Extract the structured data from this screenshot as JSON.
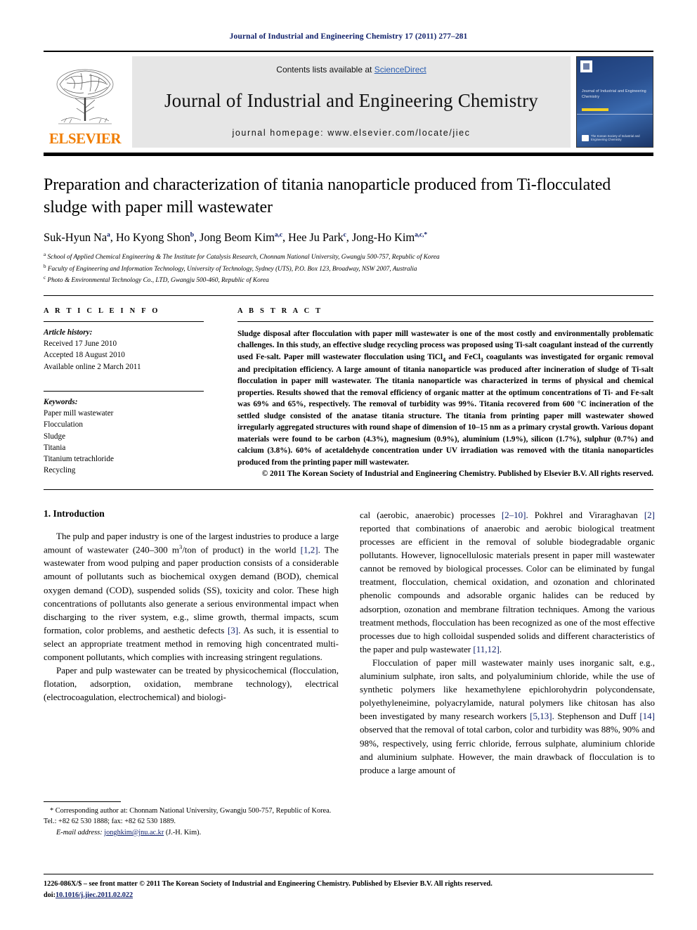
{
  "running_head": "Journal of Industrial and Engineering Chemistry 17 (2011) 277–281",
  "masthead": {
    "publisher_name": "ELSEVIER",
    "contents_prefix": "Contents lists available at ",
    "sciencedirect": "ScienceDirect",
    "journal_name": "Journal of Industrial and Engineering Chemistry",
    "homepage": "journal homepage: www.elsevier.com/locate/jiec",
    "cover_title": "Journal of Industrial and Engineering Chemistry",
    "cover_society": "The Korean Society of Industrial and Engineering Chemistry"
  },
  "article": {
    "title": "Preparation and characterization of titania nanoparticle produced from Ti-flocculated sludge with paper mill wastewater",
    "authors": [
      {
        "name": "Suk-Hyun Na",
        "marks": "a"
      },
      {
        "name": "Ho Kyong Shon",
        "marks": "b"
      },
      {
        "name": "Jong Beom Kim",
        "marks": "a,c"
      },
      {
        "name": "Hee Ju Park",
        "marks": "c"
      },
      {
        "name": "Jong-Ho Kim",
        "marks": "a,c,*"
      }
    ],
    "affiliations": [
      {
        "mark": "a",
        "text": "School of Applied Chemical Engineering & The Institute for Catalysis Research, Chonnam National University, Gwangju 500-757, Republic of Korea"
      },
      {
        "mark": "b",
        "text": "Faculty of Engineering and Information Technology, University of Technology, Sydney (UTS), P.O. Box 123, Broadway, NSW 2007, Australia"
      },
      {
        "mark": "c",
        "text": "Photo & Environmental Technology Co., LTD, Gwangju 500-460, Republic of Korea"
      }
    ]
  },
  "article_info": {
    "heading": "A R T I C L E  I N F O",
    "history_label": "Article history:",
    "history": [
      "Received 17 June 2010",
      "Accepted 18 August 2010",
      "Available online 2 March 2011"
    ],
    "keywords_label": "Keywords:",
    "keywords": [
      "Paper mill wastewater",
      "Flocculation",
      "Sludge",
      "Titania",
      "Titanium tetrachloride",
      "Recycling"
    ]
  },
  "abstract": {
    "heading": "A B S T R A C T",
    "part1": "Sludge disposal after flocculation with paper mill wastewater is one of the most costly and environmentally problematic challenges. In this study, an effective sludge recycling process was proposed using Ti-salt coagulant instead of the currently used Fe-salt. Paper mill wastewater flocculation using TiCl",
    "sub1": "4",
    "part2": " and FeCl",
    "sub2": "3",
    "part3": " coagulants was investigated for organic removal and precipitation efficiency. A large amount of titania nanoparticle was produced after incineration of sludge of Ti-salt flocculation in paper mill wastewater. The titania nanoparticle was characterized in terms of physical and chemical properties. Results showed that the removal efficiency of organic matter at the optimum concentrations of Ti- and Fe-salt was 69% and 65%, respectively. The removal of turbidity was 99%. Titania recovered from 600 °C incineration of the settled sludge consisted of the anatase titania structure. The titania from printing paper mill wastewater showed irregularly aggregated structures with round shape of dimension of 10–15 nm as a primary crystal growth. Various dopant materials were found to be carbon (4.3%), magnesium (0.9%), aluminium (1.9%), silicon (1.7%), sulphur (0.7%) and calcium (3.8%). 60% of acetaldehyde concentration under UV irradiation was removed with the titania nanoparticles produced from the printing paper mill wastewater.",
    "copyright": "© 2011 The Korean Society of Industrial and Engineering Chemistry. Published by Elsevier B.V. All rights reserved."
  },
  "body": {
    "section_title": "1. Introduction",
    "left_paragraphs": [
      "The pulp and paper industry is one of the largest industries to produce a large amount of wastewater (240–300 m3/ton of product) in the world [1,2]. The wastewater from wood pulping and paper production consists of a considerable amount of pollutants such as biochemical oxygen demand (BOD), chemical oxygen demand (COD), suspended solids (SS), toxicity and color. These high concentrations of pollutants also generate a serious environmental impact when discharging to the river system, e.g., slime growth, thermal impacts, scum formation, color problems, and aesthetic defects [3]. As such, it is essential to select an appropriate treatment method in removing high concentrated multi-component pollutants, which complies with increasing stringent regulations.",
      "Paper and pulp wastewater can be treated by physicochemical (flocculation, flotation, adsorption, oxidation, membrane technology), electrical (electrocoagulation, electrochemical) and biologi-"
    ],
    "right_paragraphs": [
      "cal (aerobic, anaerobic) processes [2–10]. Pokhrel and Viraraghavan [2] reported that combinations of anaerobic and aerobic biological treatment processes are efficient in the removal of soluble biodegradable organic pollutants. However, lignocellulosic materials present in paper mill wastewater cannot be removed by biological processes. Color can be eliminated by fungal treatment, flocculation, chemical oxidation, and ozonation and chlorinated phenolic compounds and adsorable organic halides can be reduced by adsorption, ozonation and membrane filtration techniques. Among the various treatment methods, flocculation has been recognized as one of the most effective processes due to high colloidal suspended solids and different characteristics of the paper and pulp wastewater [11,12].",
      "Flocculation of paper mill wastewater mainly uses inorganic salt, e.g., aluminium sulphate, iron salts, and polyaluminium chloride, while the use of synthetic polymers like hexamethylene epichlorohydrin polycondensate, polyethyleneimine, polyacrylamide, natural polymers like chitosan has also been investigated by many research workers [5,13]. Stephenson and Duff [14] observed that the removal of total carbon, color and turbidity was 88%, 90% and 98%, respectively, using ferric chloride, ferrous sulphate, aluminium chloride and aluminium sulphate. However, the main drawback of flocculation is to produce a large amount of"
    ]
  },
  "footnote": {
    "corresponding": "* Corresponding author at: Chonnam National University, Gwangju 500-757, Republic of Korea. Tel.: +82 62 530 1888; fax: +82 62 530 1889.",
    "email_label": "E-mail address:",
    "email": "jonghkim@jnu.ac.kr",
    "email_suffix": "(J.-H. Kim)."
  },
  "bottom": {
    "issn_line": "1226-086X/$ – see front matter © 2011 The Korean Society of Industrial and Engineering Chemistry. Published by Elsevier B.V. All rights reserved.",
    "doi_label": "doi:",
    "doi": "10.1016/j.jiec.2011.02.022"
  },
  "colors": {
    "link": "#11216b",
    "sciencedirect": "#2a5db0",
    "elsevier_orange": "#f07d00"
  }
}
